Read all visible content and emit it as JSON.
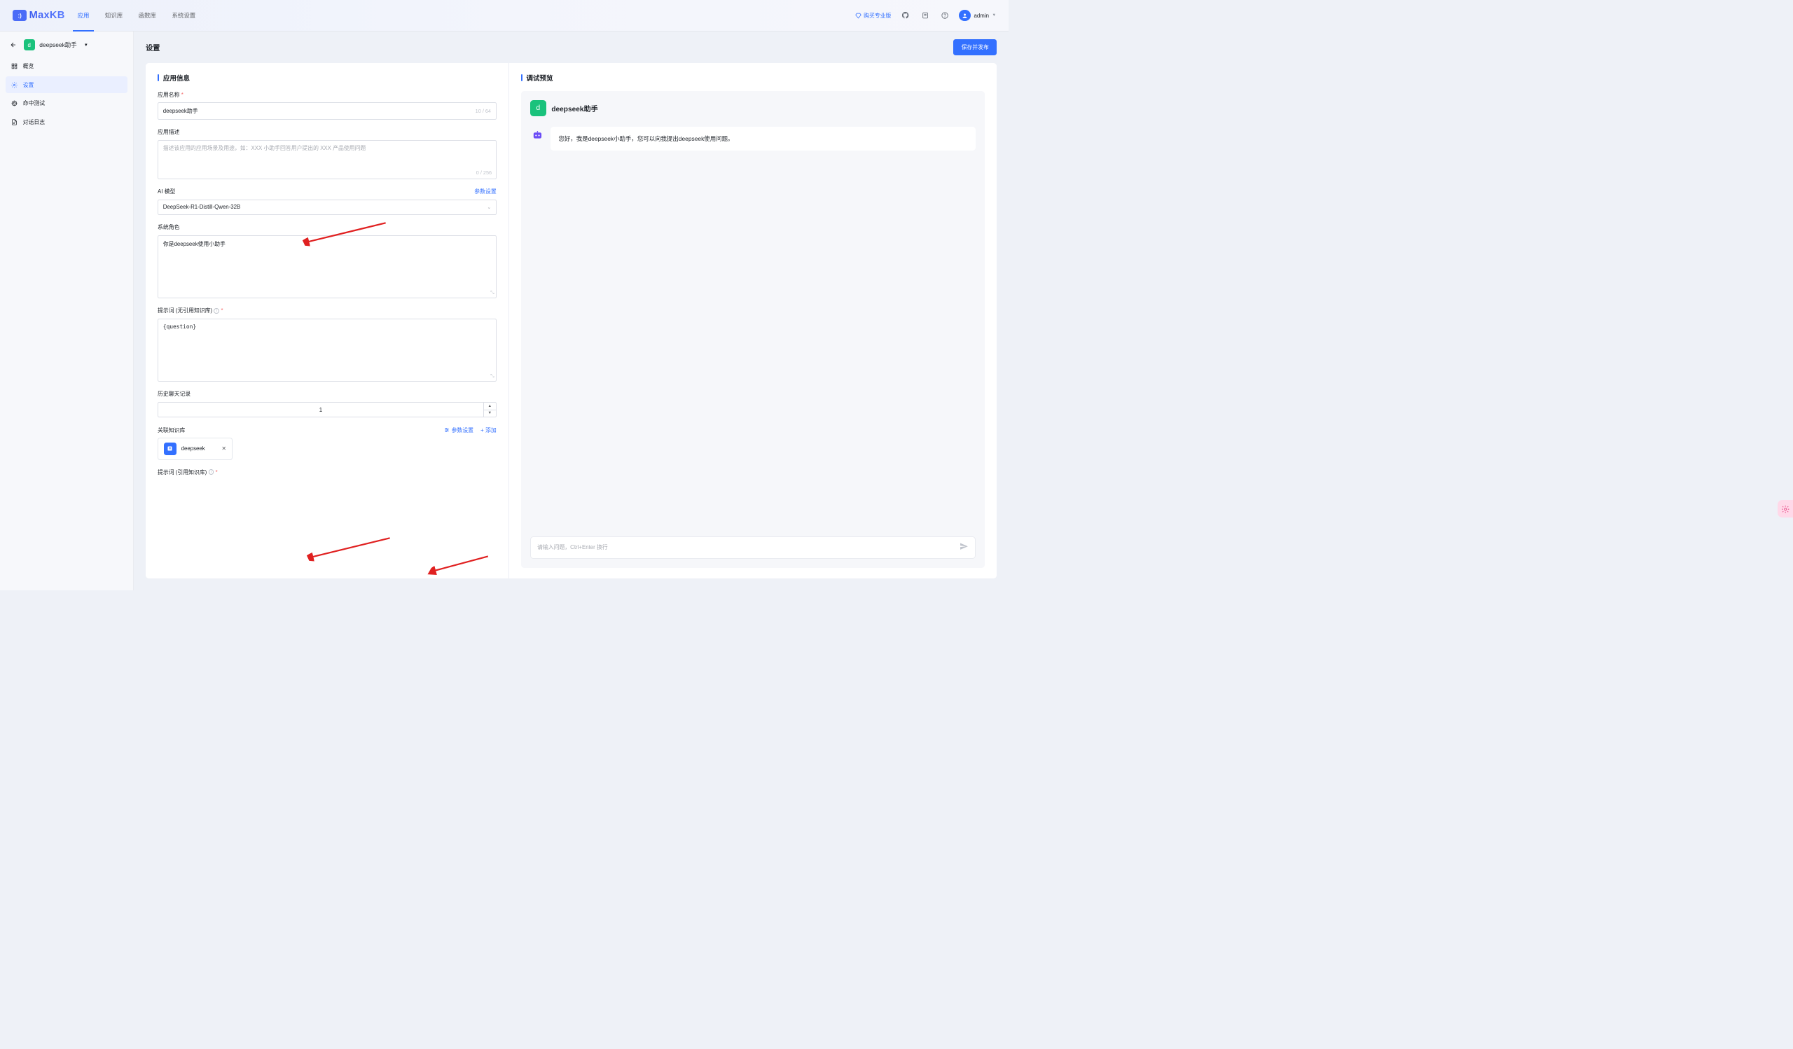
{
  "topbar": {
    "logo_text": "MaxKB",
    "tabs": [
      "应用",
      "知识库",
      "函数库",
      "系统设置"
    ],
    "active_tab": 0,
    "pro_label": "购买专业版",
    "username": "admin"
  },
  "sidebar": {
    "app_letter": "d",
    "app_name": "deepseek助手",
    "items": [
      {
        "label": "概览"
      },
      {
        "label": "设置"
      },
      {
        "label": "命中测试"
      },
      {
        "label": "对话日志"
      }
    ],
    "active": 1
  },
  "page": {
    "title": "设置",
    "save_label": "保存并发布"
  },
  "form": {
    "section_title": "应用信息",
    "app_name_label": "应用名称",
    "app_name_value": "deepseek助手",
    "app_name_counter": "10 / 64",
    "app_desc_label": "应用描述",
    "app_desc_placeholder": "描述该应用的应用场景及用途，如：XXX 小助手回答用户提出的 XXX 产品使用问题",
    "app_desc_counter": "0 / 256",
    "ai_model_label": "AI 模型",
    "ai_model_params_link": "参数设置",
    "ai_model_value": "DeepSeek-R1-Distill-Qwen-32B",
    "system_role_label": "系统角色",
    "system_role_value": "你是deepseek使用小助手",
    "prompt_nokb_label": "提示词 (无引用知识库)",
    "prompt_nokb_value": "{question}",
    "history_label": "历史聊天记录",
    "history_value": "1",
    "kb_label": "关联知识库",
    "kb_params_link": "参数设置",
    "kb_add_link": "添加",
    "kb_item_name": "deepseek",
    "prompt_kb_label": "提示词 (引用知识库)"
  },
  "preview": {
    "section_title": "调试预览",
    "app_letter": "d",
    "app_title": "deepseek助手",
    "welcome_msg": "您好，我是deepseek小助手，您可以向我提出deepseek使用问题。",
    "input_placeholder": "请输入问题，Ctrl+Enter 换行"
  }
}
